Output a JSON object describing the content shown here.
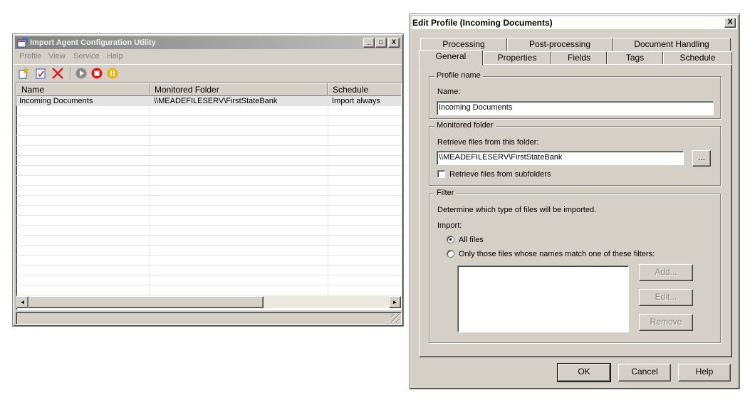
{
  "app": {
    "title": "Import Agent Configuration Utility",
    "window_buttons": [
      "_",
      "□",
      "X"
    ],
    "menu": [
      "Profile",
      "View",
      "Service",
      "Help"
    ],
    "toolbar": [
      {
        "name": "new-profile-icon"
      },
      {
        "name": "edit-profile-icon"
      },
      {
        "name": "delete-profile-icon"
      },
      {
        "name": "start-service-icon"
      },
      {
        "name": "stop-service-icon"
      },
      {
        "name": "pause-service-icon"
      }
    ],
    "list": {
      "columns": [
        "Name",
        "Monitored Folder",
        "Schedule"
      ],
      "rows": [
        [
          "Incoming Documents",
          "\\\\MEADEFILESERV\\FirstStateBank",
          "Import always"
        ]
      ]
    },
    "scroll_left": "◄",
    "scroll_right": "►"
  },
  "dialog": {
    "title": "Edit Profile (Incoming Documents)",
    "close": "X",
    "tabs_back": [
      "Processing",
      "Post-processing",
      "Document Handling"
    ],
    "tabs_front": [
      "General",
      "Properties",
      "Fields",
      "Tags",
      "Schedule"
    ],
    "active_tab": "General",
    "profile_name": {
      "legend": "Profile name",
      "label": "Name:",
      "value": "Incoming Documents"
    },
    "monitored_folder": {
      "legend": "Monitored folder",
      "label": "Retrieve files from this folder:",
      "value": "\\\\MEADEFILESERV\\FirstStateBank",
      "browse": "...",
      "subfolders_label": "Retrieve files from subfolders",
      "subfolders_checked": false
    },
    "filter": {
      "legend": "Filter",
      "description": "Determine which type of files will be imported.",
      "import_label": "Import:",
      "option_all": "All files",
      "option_match": "Only those files whose names match one of these filters:",
      "selected": "All files",
      "add": "Add...",
      "edit": "Edit...",
      "remove": "Remove"
    },
    "buttons": {
      "ok": "OK",
      "cancel": "Cancel",
      "help": "Help"
    }
  }
}
